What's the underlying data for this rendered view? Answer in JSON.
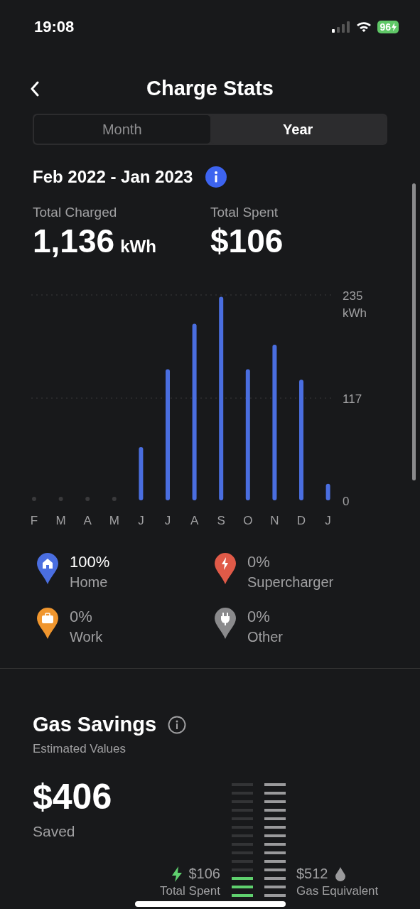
{
  "status_bar": {
    "time": "19:08",
    "battery": "96"
  },
  "header": {
    "title": "Charge Stats"
  },
  "tabs": [
    {
      "label": "Month",
      "selected": false
    },
    {
      "label": "Year",
      "selected": true
    }
  ],
  "period": {
    "label": "Feb 2022 - Jan 2023"
  },
  "totals": [
    {
      "label": "Total Charged",
      "value": "1,136",
      "unit": "kWh"
    },
    {
      "label": "Total Spent",
      "value": "$106"
    }
  ],
  "usage_chart": {
    "chart_data": {
      "type": "bar",
      "ylabel": "kWh",
      "categories": [
        "F",
        "M",
        "A",
        "M",
        "J",
        "J",
        "A",
        "S",
        "O",
        "N",
        "D",
        "J"
      ],
      "ylim": [
        0,
        235
      ],
      "yticks": [
        0,
        117,
        235
      ],
      "series": [
        {
          "color": "#4a6ee0",
          "values": [
            0,
            0,
            0,
            0,
            61,
            150,
            202,
            233,
            150,
            178,
            138,
            19
          ]
        }
      ]
    }
  },
  "locations": [
    {
      "kind": "home",
      "percent": "100%",
      "label": "Home",
      "color": "#4a6ee0",
      "selected": true
    },
    {
      "kind": "supercharger",
      "percent": "0%",
      "label": "Supercharger",
      "color": "#e05a48",
      "selected": false
    },
    {
      "kind": "work",
      "percent": "0%",
      "label": "Work",
      "color": "#f0962e",
      "selected": false
    },
    {
      "kind": "other",
      "percent": "0%",
      "label": "Other",
      "color": "#8a8a8c",
      "selected": false
    }
  ],
  "gas_savings": {
    "title": "Gas Savings",
    "subtitle": "Estimated Values",
    "amount": "$406",
    "amount_label": "Saved",
    "spent": {
      "value": "$106",
      "label": "Total Spent",
      "level": 0.2
    },
    "gas": {
      "value": "$512",
      "label": "Gas Equivalent",
      "level": 1
    }
  }
}
